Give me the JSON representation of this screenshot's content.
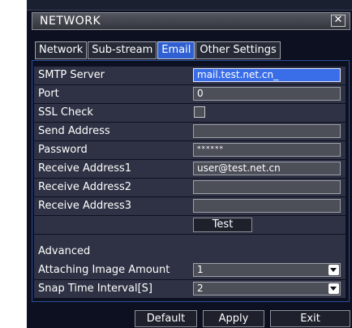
{
  "window": {
    "title": "NETWORK",
    "close_symbol": "✕"
  },
  "tabs": [
    {
      "label": "Network"
    },
    {
      "label": "Sub-stream"
    },
    {
      "label": "Email",
      "active": true
    },
    {
      "label": "Other Settings"
    }
  ],
  "form": {
    "smtp_server": {
      "label": "SMTP Server",
      "value": "mail.test.net.cn_"
    },
    "port": {
      "label": "Port",
      "value": "0"
    },
    "ssl_check": {
      "label": "SSL Check",
      "checked": false
    },
    "send_address": {
      "label": "Send Address",
      "value": ""
    },
    "password": {
      "label": "Password",
      "value": "******"
    },
    "receive_address1": {
      "label": "Receive Address1",
      "value": "user@test.net.cn"
    },
    "receive_address2": {
      "label": "Receive Address2",
      "value": ""
    },
    "receive_address3": {
      "label": "Receive Address3",
      "value": ""
    },
    "test_button": "Test",
    "advanced_label": "Advanced",
    "attaching_image_amount": {
      "label": "Attaching Image Amount",
      "value": "1"
    },
    "snap_time_interval": {
      "label": "Snap Time Interval[S]",
      "value": "2"
    }
  },
  "footer": {
    "default_label": "Default",
    "apply_label": "Apply",
    "exit_label": "Exit"
  },
  "colors": {
    "background": "#0c1020",
    "row": "#2f3244",
    "active_tab": "#2f5fd0",
    "active_field": "#3a6ee8",
    "panel_border": "#2c4e9a"
  }
}
